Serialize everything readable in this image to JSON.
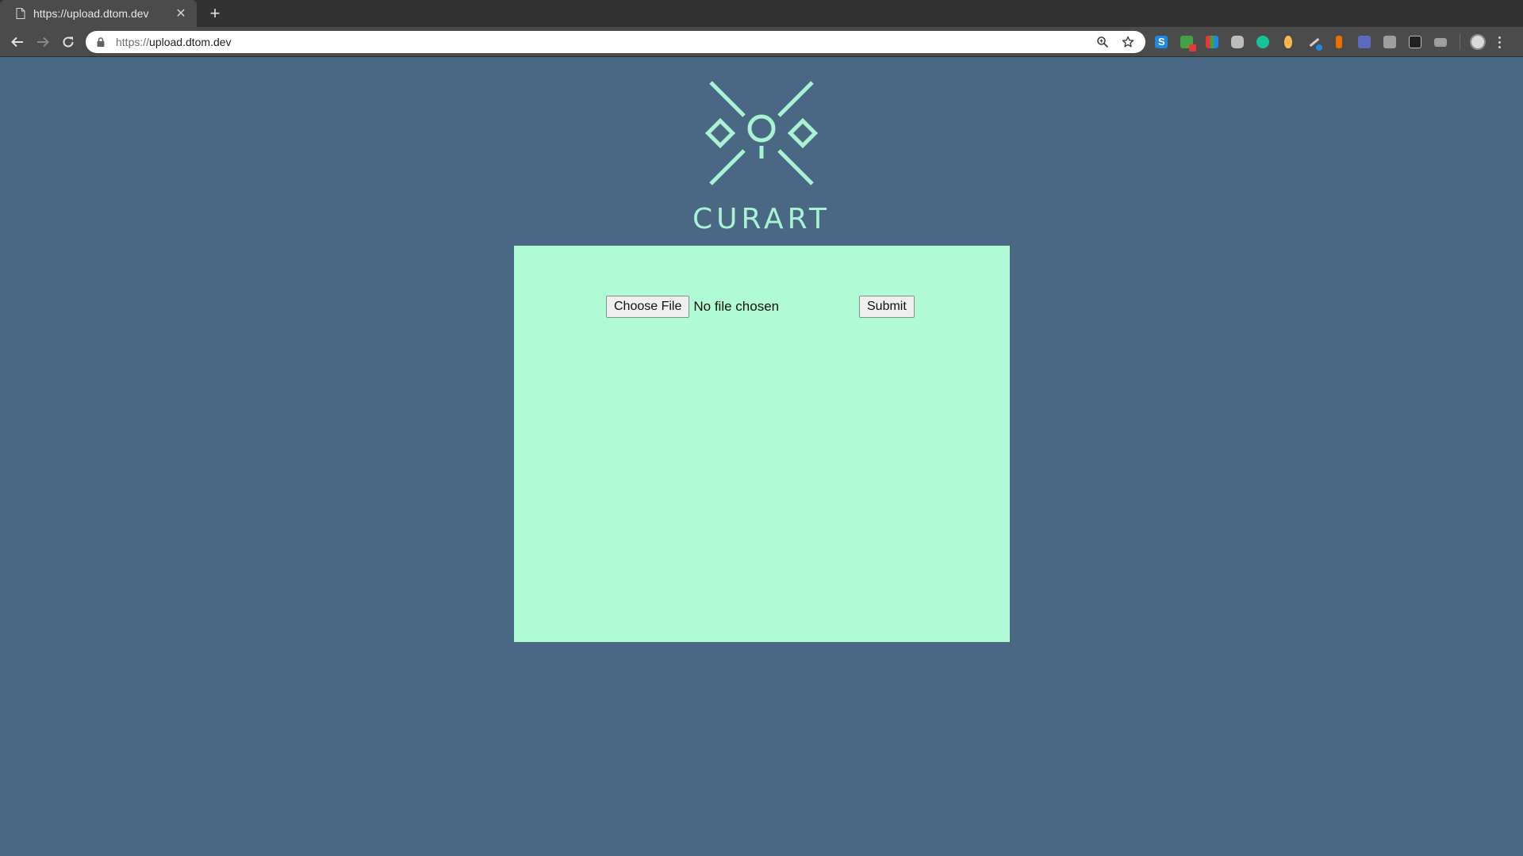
{
  "browser": {
    "tab_title": "https://upload.dtom.dev",
    "url_scheme": "https://",
    "url_host": "upload.dtom.dev",
    "extension_icons": [
      "skype-icon",
      "badge-ext-icon",
      "grid-ext-icon",
      "drive-ext-icon",
      "grammarly-icon",
      "droplet-ext-icon",
      "pen-ext-icon",
      "bookmark-ext-icon",
      "image-ext-icon",
      "k-ext-icon",
      "printer-ext-icon",
      "mail-ext-icon"
    ]
  },
  "brand": {
    "name": "CURART",
    "accent_color": "#a9f2d4"
  },
  "upload": {
    "choose_file_label": "Choose File",
    "file_status": "No file chosen",
    "submit_label": "Submit",
    "panel_color": "#b0fad5"
  },
  "colors": {
    "page_background": "#4a6883"
  }
}
